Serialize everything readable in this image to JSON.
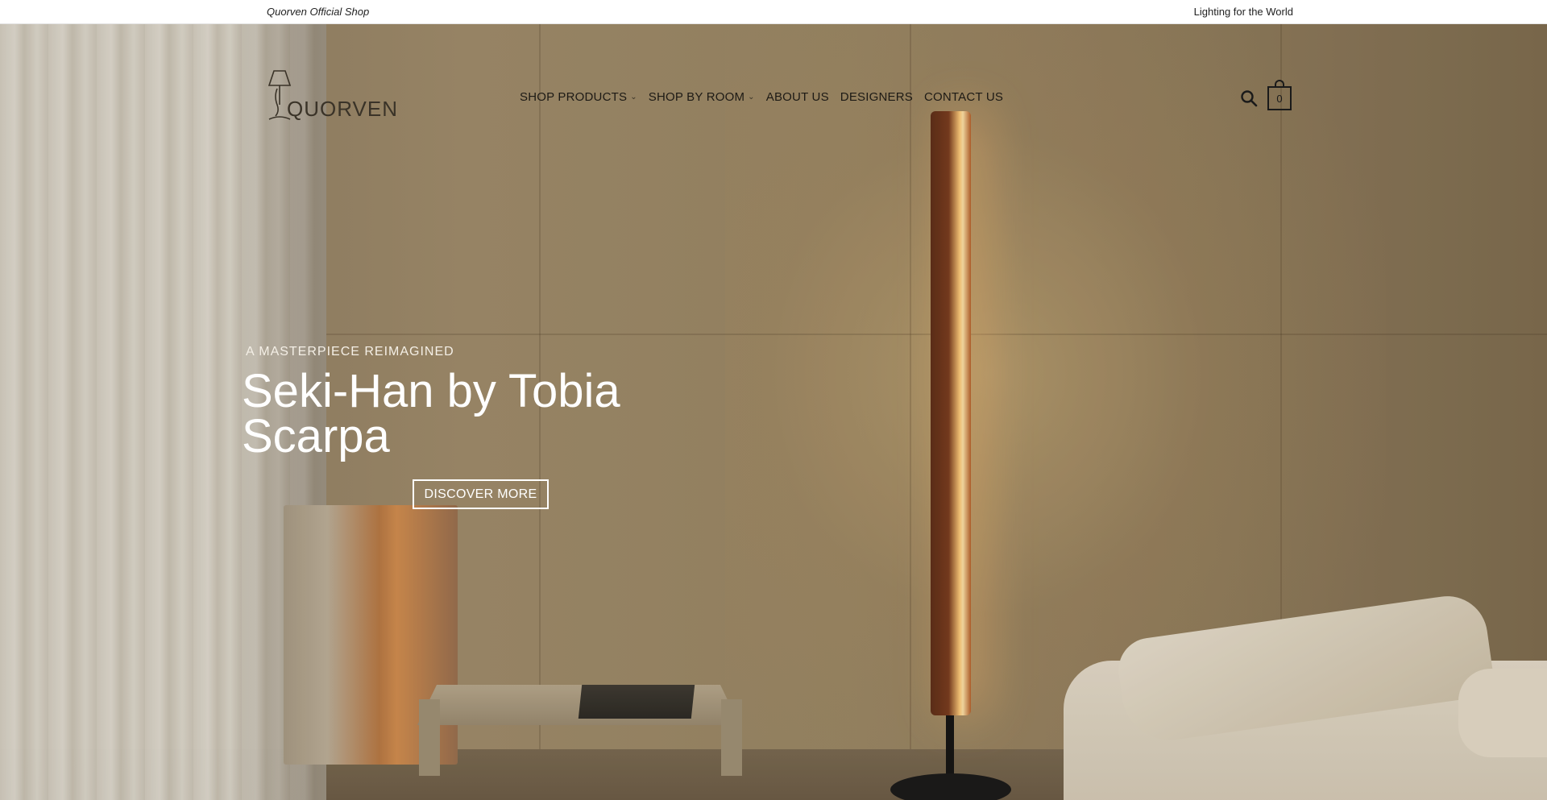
{
  "topbar": {
    "left_text": "Quorven Official Shop",
    "right_text": "Lighting for the World"
  },
  "header": {
    "logo_text": "QUORVEN",
    "nav": [
      {
        "label": "SHOP PRODUCTS",
        "has_dropdown": true
      },
      {
        "label": "SHOP BY ROOM",
        "has_dropdown": true
      },
      {
        "label": "ABOUT US",
        "has_dropdown": false
      },
      {
        "label": "DESIGNERS",
        "has_dropdown": false
      },
      {
        "label": "CONTACT US",
        "has_dropdown": false
      }
    ],
    "search_icon": "search-icon",
    "cart_count": "0"
  },
  "hero": {
    "eyebrow": "A MASTERPIECE REIMAGINED",
    "headline": "Seki-Han by Tobia Scarpa",
    "cta_label": "DISCOVER MORE"
  },
  "colors": {
    "text_dark": "#1a1a1a",
    "hero_text": "#ffffff",
    "lamp_glow": "#ffcb7a"
  }
}
